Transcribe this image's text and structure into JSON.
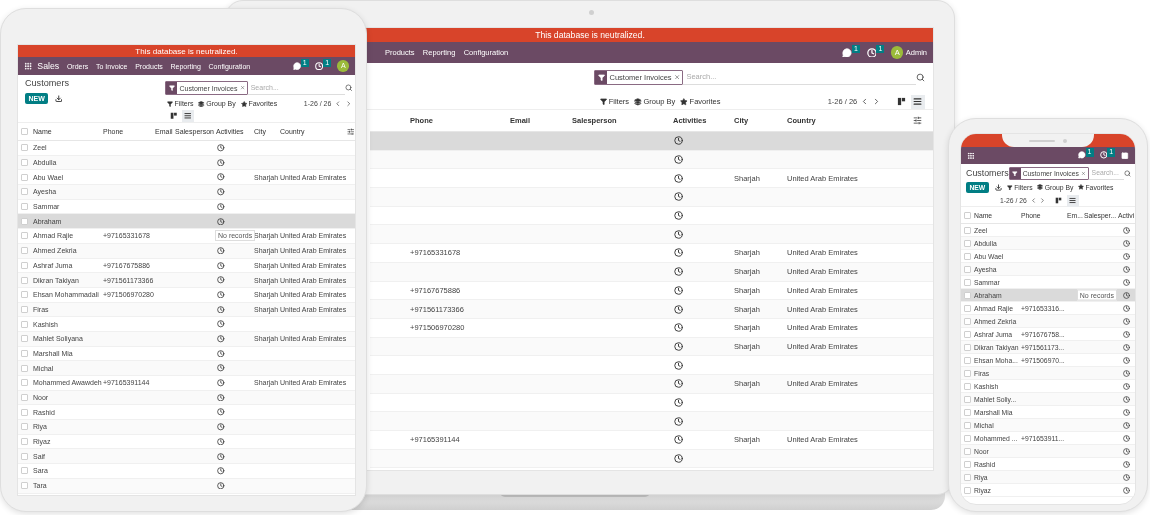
{
  "devices": [
    {
      "kind": "laptop",
      "banner": "This database is neutralized.",
      "nav": {
        "items": [
          "Products",
          "Reporting",
          "Configuration"
        ],
        "messages": "1",
        "activities": "1",
        "avatar": "A",
        "user": "Admin"
      },
      "search": {
        "facet": "Customer Invoices",
        "placeholder": "Search..."
      },
      "toolbar": {
        "filters": "Filters",
        "group_by": "Group By",
        "favorites": "Favorites",
        "pager": "1-26 / 26"
      },
      "views": [
        {
          "kind": "kanban",
          "selected": false
        },
        {
          "kind": "list",
          "selected": true
        }
      ],
      "columns": [
        {
          "kind": "phone",
          "label": "Phone"
        },
        {
          "kind": "email",
          "label": "Email"
        },
        {
          "kind": "salesperson",
          "label": "Salesperson"
        },
        {
          "kind": "activities",
          "label": "Activities"
        },
        {
          "kind": "city",
          "label": "City"
        },
        {
          "kind": "country",
          "label": "Country"
        }
      ],
      "rows": [
        {
          "hovered": true
        },
        {
          "hovered": false
        },
        {
          "hovered": false,
          "city": "Sharjah",
          "country": "United Arab Emirates"
        },
        {
          "hovered": false
        },
        {
          "hovered": false
        },
        {
          "hovered": false
        },
        {
          "hovered": false,
          "phone": "+97165331678",
          "city": "Sharjah",
          "country": "United Arab Emirates"
        },
        {
          "hovered": false,
          "city": "Sharjah",
          "country": "United Arab Emirates"
        },
        {
          "hovered": false,
          "phone": "+97167675886",
          "city": "Sharjah",
          "country": "United Arab Emirates"
        },
        {
          "hovered": false,
          "phone": "+971561173366",
          "city": "Sharjah",
          "country": "United Arab Emirates"
        },
        {
          "hovered": false,
          "phone": "+971506970280",
          "city": "Sharjah",
          "country": "United Arab Emirates"
        },
        {
          "hovered": false,
          "city": "Sharjah",
          "country": "United Arab Emirates"
        },
        {
          "hovered": false
        },
        {
          "hovered": false,
          "city": "Sharjah",
          "country": "United Arab Emirates"
        },
        {
          "hovered": false
        },
        {
          "hovered": false
        },
        {
          "hovered": false,
          "phone": "+97165391144",
          "city": "Sharjah",
          "country": "United Arab Emirates"
        },
        {
          "hovered": false
        }
      ]
    },
    {
      "kind": "tablet",
      "banner": "This database is neutralized.",
      "nav": {
        "app": "Sales",
        "items": [
          "Orders",
          "To Invoice",
          "Products",
          "Reporting",
          "Configuration"
        ],
        "messages": "1",
        "activities": "1",
        "avatar": "A"
      },
      "title": "Customers",
      "new_button": "NEW",
      "search": {
        "facet": "Customer Invoices",
        "placeholder": "Search..."
      },
      "toolbar": {
        "filters": "Filters",
        "group_by": "Group By",
        "favorites": "Favorites",
        "pager": "1-26 / 26"
      },
      "views": [
        {
          "kind": "kanban",
          "selected": false
        },
        {
          "kind": "list",
          "selected": true
        }
      ],
      "all_checked": false,
      "columns": [
        {
          "kind": "name",
          "label": "Name"
        },
        {
          "kind": "phone",
          "label": "Phone"
        },
        {
          "kind": "email",
          "label": "Email"
        },
        {
          "kind": "salesperson",
          "label": "Salesperson"
        },
        {
          "kind": "activities",
          "label": "Activities"
        },
        {
          "kind": "city",
          "label": "City"
        },
        {
          "kind": "country",
          "label": "Country"
        }
      ],
      "rows": [
        {
          "checked": false,
          "hovered": false,
          "name": "Zeel"
        },
        {
          "checked": false,
          "hovered": false,
          "name": "Abdulla"
        },
        {
          "checked": false,
          "hovered": false,
          "name": "Abu Wael",
          "city": "Sharjah",
          "country": "United Arab Emirates"
        },
        {
          "checked": false,
          "hovered": false,
          "name": "Ayesha"
        },
        {
          "checked": false,
          "hovered": false,
          "name": "Sammar"
        },
        {
          "checked": false,
          "hovered": true,
          "name": "Abraham"
        },
        {
          "checked": false,
          "hovered": false,
          "name": "Ahmad Rajie",
          "phone": "+97165331678",
          "tooltip": "No records",
          "city": "Sharjah",
          "country": "United Arab Emirates"
        },
        {
          "checked": false,
          "hovered": false,
          "name": "Ahmed Zekria",
          "city": "Sharjah",
          "country": "United Arab Emirates"
        },
        {
          "checked": false,
          "hovered": false,
          "name": "Ashraf Juma",
          "phone": "+97167675886",
          "city": "Sharjah",
          "country": "United Arab Emirates"
        },
        {
          "checked": false,
          "hovered": false,
          "name": "Dikran Takiyan",
          "phone": "+971561173366",
          "city": "Sharjah",
          "country": "United Arab Emirates"
        },
        {
          "checked": false,
          "hovered": false,
          "name": "Ehsan Mohammadali",
          "phone": "+971506970280",
          "city": "Sharjah",
          "country": "United Arab Emirates"
        },
        {
          "checked": false,
          "hovered": false,
          "name": "Firas",
          "city": "Sharjah",
          "country": "United Arab Emirates"
        },
        {
          "checked": false,
          "hovered": false,
          "name": "Kashish"
        },
        {
          "checked": false,
          "hovered": false,
          "name": "Mahlet Soliyana",
          "city": "Sharjah",
          "country": "United Arab Emirates"
        },
        {
          "checked": false,
          "hovered": false,
          "name": "Marshall Mia"
        },
        {
          "checked": false,
          "hovered": false,
          "name": "Michal"
        },
        {
          "checked": false,
          "hovered": false,
          "name": "Mohammed Awawdeh",
          "phone": "+97165391144",
          "city": "Sharjah",
          "country": "United Arab Emirates"
        },
        {
          "checked": false,
          "hovered": false,
          "name": "Noor"
        },
        {
          "checked": false,
          "hovered": false,
          "name": "Rashid"
        },
        {
          "checked": false,
          "hovered": false,
          "name": "Riya"
        },
        {
          "checked": false,
          "hovered": false,
          "name": "Riyaz"
        },
        {
          "checked": false,
          "hovered": false,
          "name": "Saif"
        },
        {
          "checked": false,
          "hovered": false,
          "name": "Sara"
        },
        {
          "checked": false,
          "hovered": false,
          "name": "Tara"
        }
      ]
    },
    {
      "kind": "phone",
      "nav": {
        "messages": "1",
        "activities": "1"
      },
      "title": "Customers",
      "new_button": "NEW",
      "search": {
        "facet": "Customer Invoices",
        "placeholder": "Search..."
      },
      "toolbar": {
        "filters": "Filters",
        "group_by": "Group By",
        "favorites": "Favorites",
        "pager": "1-26 / 26"
      },
      "views": [
        {
          "kind": "kanban",
          "selected": false
        },
        {
          "kind": "list",
          "selected": true
        }
      ],
      "all_checked": false,
      "columns": [
        {
          "kind": "name",
          "label": "Name"
        },
        {
          "kind": "phone",
          "label": "Phone"
        },
        {
          "kind": "email",
          "label": "Em..."
        },
        {
          "kind": "salesperson",
          "label": "Salesper..."
        },
        {
          "kind": "activities",
          "label": "Activi"
        }
      ],
      "rows": [
        {
          "checked": false,
          "hovered": false,
          "name": "Zeel"
        },
        {
          "checked": false,
          "hovered": false,
          "name": "Abdulla"
        },
        {
          "checked": false,
          "hovered": false,
          "name": "Abu Wael"
        },
        {
          "checked": false,
          "hovered": false,
          "name": "Ayesha"
        },
        {
          "checked": false,
          "hovered": false,
          "name": "Sammar"
        },
        {
          "checked": false,
          "hovered": true,
          "name": "Abraham",
          "tooltip": "No records"
        },
        {
          "checked": false,
          "hovered": false,
          "name": "Ahmad Rajie",
          "phone": "+971653316..."
        },
        {
          "checked": false,
          "hovered": false,
          "name": "Ahmed Zekria"
        },
        {
          "checked": false,
          "hovered": false,
          "name": "Ashraf Juma",
          "phone": "+971676758..."
        },
        {
          "checked": false,
          "hovered": false,
          "name": "Dikran Takiyan",
          "phone": "+971561173..."
        },
        {
          "checked": false,
          "hovered": false,
          "name": "Ehsan Moha...",
          "phone": "+971506970..."
        },
        {
          "checked": false,
          "hovered": false,
          "name": "Firas"
        },
        {
          "checked": false,
          "hovered": false,
          "name": "Kashish"
        },
        {
          "checked": false,
          "hovered": false,
          "name": "Mahlet Soliy..."
        },
        {
          "checked": false,
          "hovered": false,
          "name": "Marshall Mia"
        },
        {
          "checked": false,
          "hovered": false,
          "name": "Michal"
        },
        {
          "checked": false,
          "hovered": false,
          "name": "Mohammed ...",
          "phone": "+971653911..."
        },
        {
          "checked": false,
          "hovered": false,
          "name": "Noor"
        },
        {
          "checked": false,
          "hovered": false,
          "name": "Rashid"
        },
        {
          "checked": false,
          "hovered": false,
          "name": "Riya"
        },
        {
          "checked": false,
          "hovered": false,
          "name": "Riyaz"
        }
      ]
    }
  ]
}
